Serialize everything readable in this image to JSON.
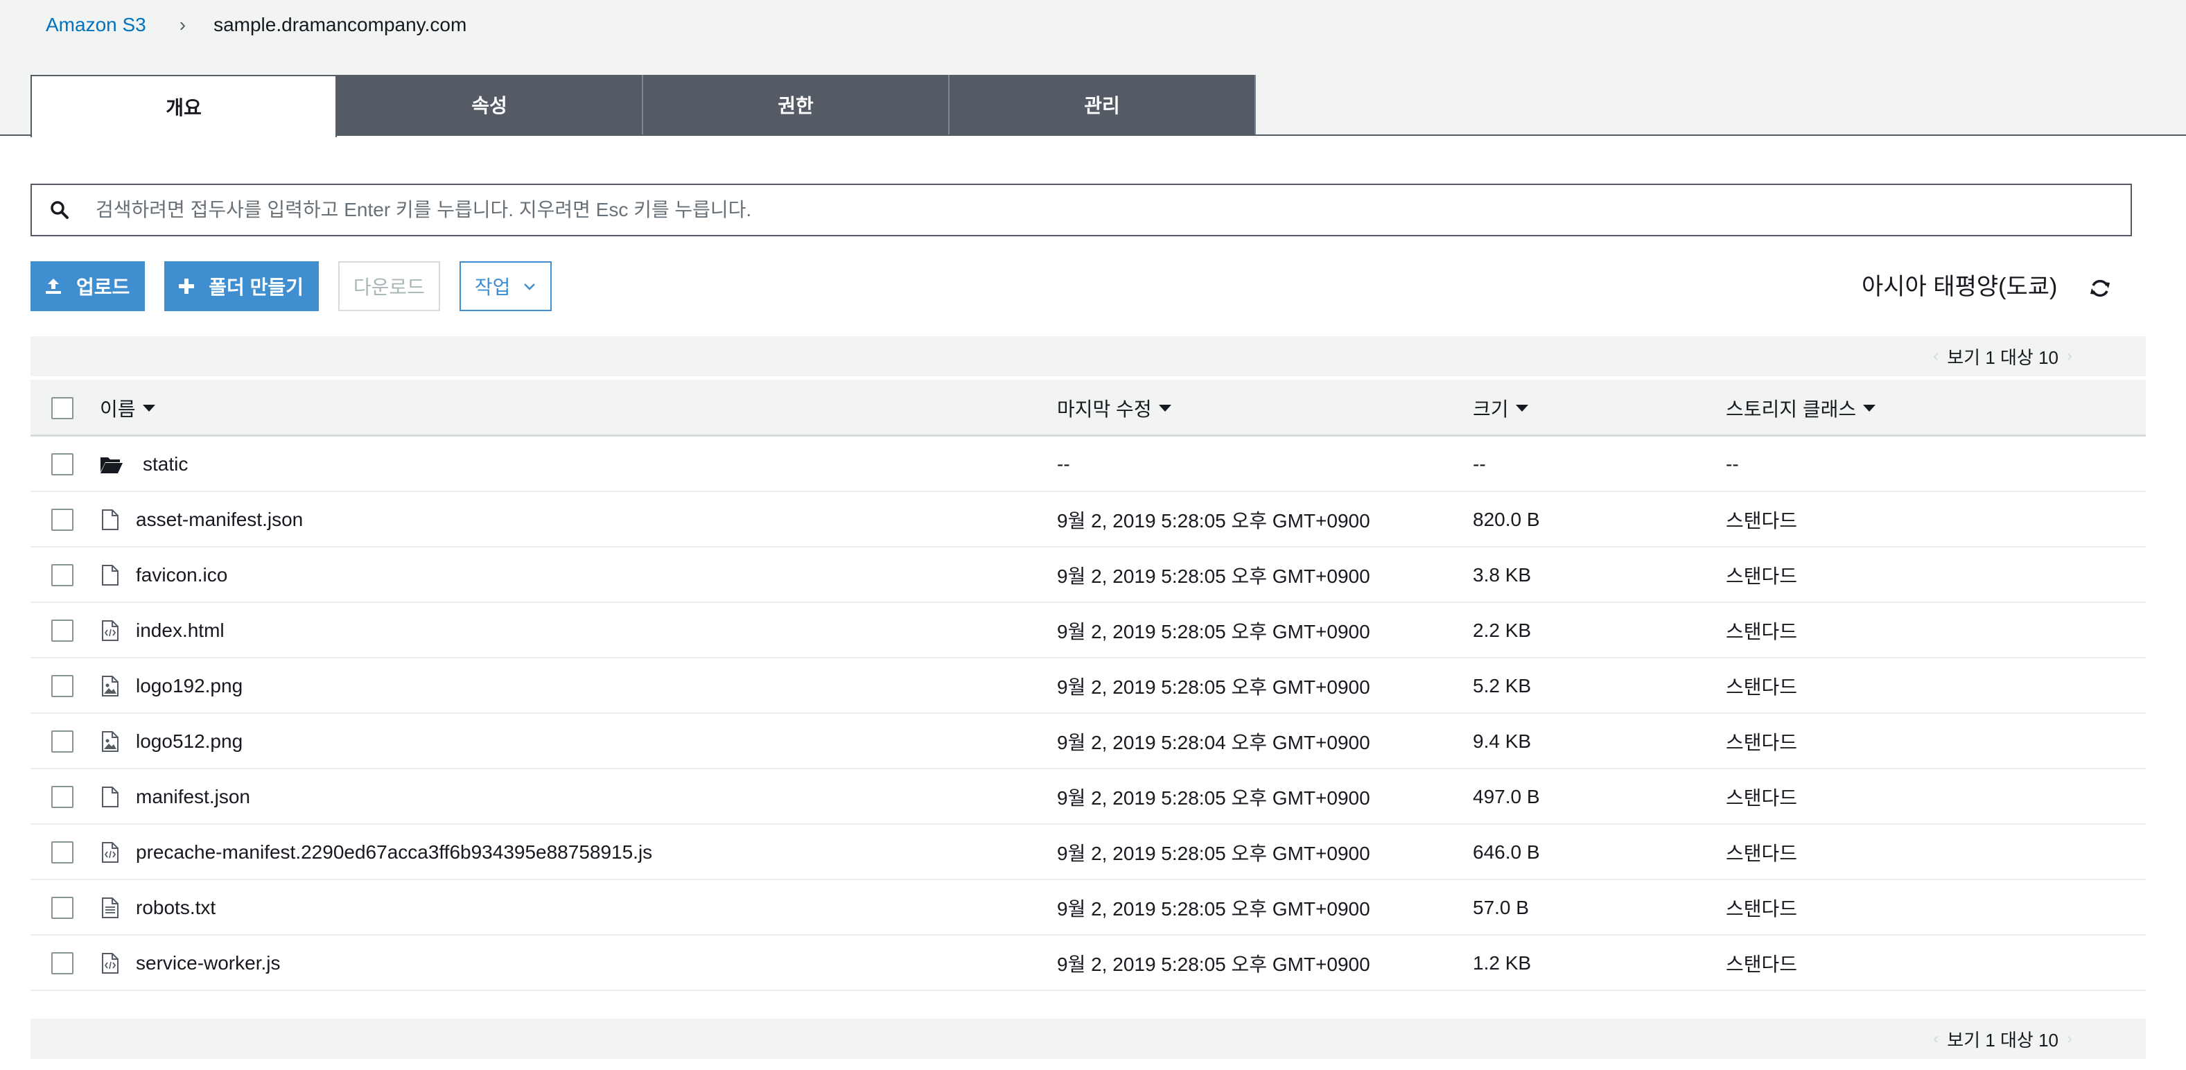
{
  "breadcrumb": {
    "root": "Amazon S3",
    "separator": "›",
    "current": "sample.dramancompany.com"
  },
  "tabs": [
    {
      "label": "개요",
      "active": true
    },
    {
      "label": "속성",
      "active": false
    },
    {
      "label": "권한",
      "active": false
    },
    {
      "label": "관리",
      "active": false
    }
  ],
  "search": {
    "placeholder": "검색하려면 접두사를 입력하고 Enter 키를 누릅니다. 지우려면 Esc 키를 누릅니다.",
    "value": ""
  },
  "toolbar": {
    "upload_label": "업로드",
    "create_folder_label": "폴더 만들기",
    "download_label": "다운로드",
    "actions_label": "작업"
  },
  "region": "아시아 태평양(도쿄)",
  "pager": {
    "text": "보기 1 대상 10",
    "prev": "‹",
    "next": "›"
  },
  "table": {
    "columns": {
      "name": "이름",
      "modified": "마지막 수정",
      "size": "크기",
      "storage_class": "스토리지 클래스"
    },
    "rows": [
      {
        "name": "static",
        "icon": "folder-icon",
        "modified": "--",
        "size": "--",
        "storage_class": "--"
      },
      {
        "name": "asset-manifest.json",
        "icon": "file-icon",
        "modified": "9월 2, 2019 5:28:05 오후 GMT+0900",
        "size": "820.0 B",
        "storage_class": "스탠다드"
      },
      {
        "name": "favicon.ico",
        "icon": "file-icon",
        "modified": "9월 2, 2019 5:28:05 오후 GMT+0900",
        "size": "3.8 KB",
        "storage_class": "스탠다드"
      },
      {
        "name": "index.html",
        "icon": "code-file-icon",
        "modified": "9월 2, 2019 5:28:05 오후 GMT+0900",
        "size": "2.2 KB",
        "storage_class": "스탠다드"
      },
      {
        "name": "logo192.png",
        "icon": "image-file-icon",
        "modified": "9월 2, 2019 5:28:05 오후 GMT+0900",
        "size": "5.2 KB",
        "storage_class": "스탠다드"
      },
      {
        "name": "logo512.png",
        "icon": "image-file-icon",
        "modified": "9월 2, 2019 5:28:04 오후 GMT+0900",
        "size": "9.4 KB",
        "storage_class": "스탠다드"
      },
      {
        "name": "manifest.json",
        "icon": "file-icon",
        "modified": "9월 2, 2019 5:28:05 오후 GMT+0900",
        "size": "497.0 B",
        "storage_class": "스탠다드"
      },
      {
        "name": "precache-manifest.2290ed67acca3ff6b934395e88758915.js",
        "icon": "code-file-icon",
        "modified": "9월 2, 2019 5:28:05 오후 GMT+0900",
        "size": "646.0 B",
        "storage_class": "스탠다드"
      },
      {
        "name": "robots.txt",
        "icon": "text-file-icon",
        "modified": "9월 2, 2019 5:28:05 오후 GMT+0900",
        "size": "57.0 B",
        "storage_class": "스탠다드"
      },
      {
        "name": "service-worker.js",
        "icon": "code-file-icon",
        "modified": "9월 2, 2019 5:28:05 오후 GMT+0900",
        "size": "1.2 KB",
        "storage_class": "스탠다드"
      }
    ]
  },
  "colors": {
    "accent": "#3e8ed0",
    "link": "#0073bb",
    "tab_inactive": "#545b64",
    "band": "#f2f3f3"
  }
}
